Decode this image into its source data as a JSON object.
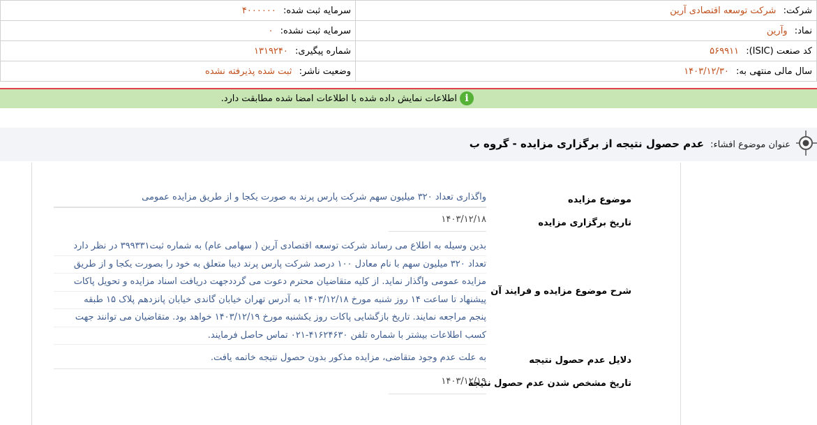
{
  "company_info": [
    {
      "left_label": "سرمایه ثبت شده:",
      "left_value": "۴۰۰۰۰۰۰",
      "right_label": "شرکت:",
      "right_value": "شرکت توسعه اقتصادی آرین"
    },
    {
      "left_label": "سرمایه ثبت نشده:",
      "left_value": "۰",
      "right_label": "نماد:",
      "right_value": "وآرین"
    },
    {
      "left_label": "شماره پیگیری:",
      "left_value": "۱۳۱۹۲۴۰",
      "right_label": "کد صنعت (ISIC):",
      "right_value": "۵۶۹۹۱۱"
    },
    {
      "left_label": "وضعیت ناشر:",
      "left_value": "ثبت شده پذیرفته نشده",
      "right_label": "سال مالی منتهی به:",
      "right_value": "۱۴۰۳/۱۲/۳۰"
    }
  ],
  "notice": {
    "icon": "info-icon",
    "text": "اطلاعات نمایش داده شده با اطلاعات امضا شده مطابقت دارد."
  },
  "disclosure": {
    "icon": "target-icon",
    "label": "عنوان موضوع افشاء:",
    "title": "عدم حصول نتیجه از برگزاری مزایده - گروه ب"
  },
  "details": {
    "subject_label": "موضوع مزایده",
    "subject_value": "واگذاری تعداد ۳۲۰ میلیون سهم شرکت پارس پرند به صورت یکجا و از طریق مزایده عمومی",
    "date_label": "تاریخ برگزاری مزایده",
    "date_value": "۱۴۰۳/۱۲/۱۸",
    "desc_label": "شرح موضوع مزایده و فرایند آن",
    "desc_lines": [
      "بدین وسیله به اطلاع می رساند شرکت توسعه اقتصادی آرین ( سهامی عام) به شماره ثبت۳۹۹۳۳۱ در نظر دارد",
      "تعداد ۳۲۰ میلیون سهم با نام معادل ۱۰۰ درصد شرکت پارس پرند دیبا متعلق به خود را بصورت یکجا و از طریق",
      "مزایده عمومی واگذار نماید. از کلیه متقاضیان محترم دعوت می گرددجهت دریافت اسناد مزایده و تحویل پاکات",
      "پیشنهاد تا ساعت ۱۴ روز شنبه مورخ ۱۴۰۳/۱۲/۱۸ به آدرس تهران خیابان گاندی خیابان پانزدهم پلاک ۱۵ طبقه",
      "پنجم مراجعه نمایند. تاریخ بازگشایی پاکات روز یکشنبه مورخ ۱۴۰۳/۱۲/۱۹ خواهد بود. متقاضیان می توانند جهت",
      "کسب اطلاعات بیشتر با شماره تلفن ۴۱۶۲۴۶۳۰-۰۲۱ تماس حاصل فرمایند."
    ],
    "reason_label": "دلایل عدم حصول نتیجه",
    "reason_value": "به علت عدم وجود متقاضی، مزایده مذکور بدون حصول نتیجه خاتمه یافت.",
    "result_date_label": "تاریخ مشخص شدن عدم حصول نتیجه",
    "result_date_value": "۱۴۰۳/۱۲/۱۹"
  }
}
